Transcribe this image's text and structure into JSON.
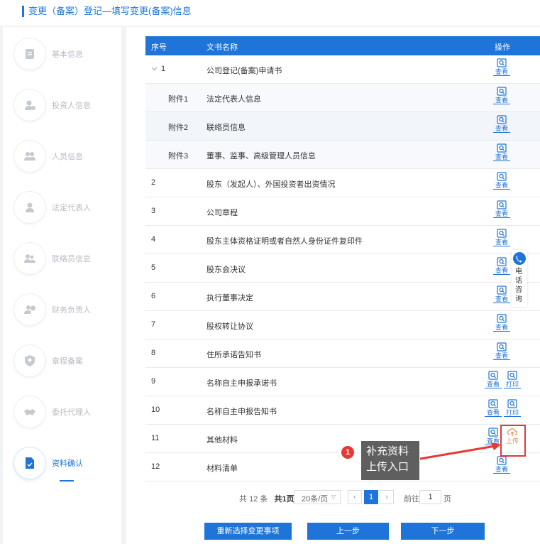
{
  "header": {
    "title": "变更（备案）登记—填写变更(备案)信息"
  },
  "sidebar": {
    "steps": [
      {
        "label": "基本信息",
        "icon": "document-icon"
      },
      {
        "label": "投资人信息",
        "icon": "investor-icon"
      },
      {
        "label": "人员信息",
        "icon": "people-icon"
      },
      {
        "label": "法定代表人",
        "icon": "legal-rep-icon"
      },
      {
        "label": "联络员信息",
        "icon": "contact-person-icon"
      },
      {
        "label": "财务负责人",
        "icon": "finance-icon"
      },
      {
        "label": "章程备案",
        "icon": "shield-icon"
      },
      {
        "label": "委托代理人",
        "icon": "handshake-icon"
      },
      {
        "label": "资料确认",
        "icon": "file-check-icon",
        "active": true
      }
    ]
  },
  "table": {
    "headers": {
      "index": "序号",
      "name": "文书名称",
      "ops": "操作"
    },
    "rows": [
      {
        "index": "1",
        "name": "公司登记(备案)申请书",
        "ops": [
          "查看"
        ]
      },
      {
        "index": "附件1",
        "name": "法定代表人信息",
        "ops": [
          "查看"
        ]
      },
      {
        "index": "附件2",
        "name": "联络员信息",
        "ops": [
          "查看"
        ]
      },
      {
        "index": "附件3",
        "name": "董事、监事、高级管理人员信息",
        "ops": [
          "查看"
        ]
      },
      {
        "index": "2",
        "name": "股东（发起人）、外国投资者出资情况",
        "ops": [
          "查看"
        ]
      },
      {
        "index": "3",
        "name": "公司章程",
        "ops": [
          "查看"
        ]
      },
      {
        "index": "4",
        "name": "股东主体资格证明或者自然人身份证件复印件",
        "ops": [
          "查看"
        ]
      },
      {
        "index": "5",
        "name": "股东会决议",
        "ops": [
          "查看"
        ]
      },
      {
        "index": "6",
        "name": "执行董事决定",
        "ops": [
          "查看"
        ]
      },
      {
        "index": "7",
        "name": "股权转让协议",
        "ops": [
          "查看"
        ]
      },
      {
        "index": "8",
        "name": "住所承诺告知书",
        "ops": [
          "查看"
        ]
      },
      {
        "index": "9",
        "name": "名称自主申报承诺书",
        "ops": [
          "查看",
          "打印"
        ]
      },
      {
        "index": "10",
        "name": "名称自主申报告知书",
        "ops": [
          "查看",
          "打印"
        ]
      },
      {
        "index": "11",
        "name": "其他材料",
        "ops": [
          "查看",
          "上传"
        ]
      },
      {
        "index": "12",
        "name": "材料清单",
        "ops": [
          "查看"
        ]
      }
    ]
  },
  "callout": {
    "badge": "1",
    "line1": "补充资料",
    "line2": "上传入口"
  },
  "contact": {
    "text": "电话咨询"
  },
  "pagination": {
    "total_prefix": "共",
    "total": "12",
    "total_suffix": "条",
    "pages": "共1页",
    "page_size": "20条/页",
    "current": "1",
    "goto_label": "前往",
    "goto_value": "1",
    "page_label": "页"
  },
  "buttons": {
    "reselect": "重新选择变更事项",
    "prev": "上一步",
    "next": "下一步"
  },
  "colors": {
    "primary": "#1e74d8",
    "upload": "#e8894b",
    "highlight": "#e53935"
  }
}
